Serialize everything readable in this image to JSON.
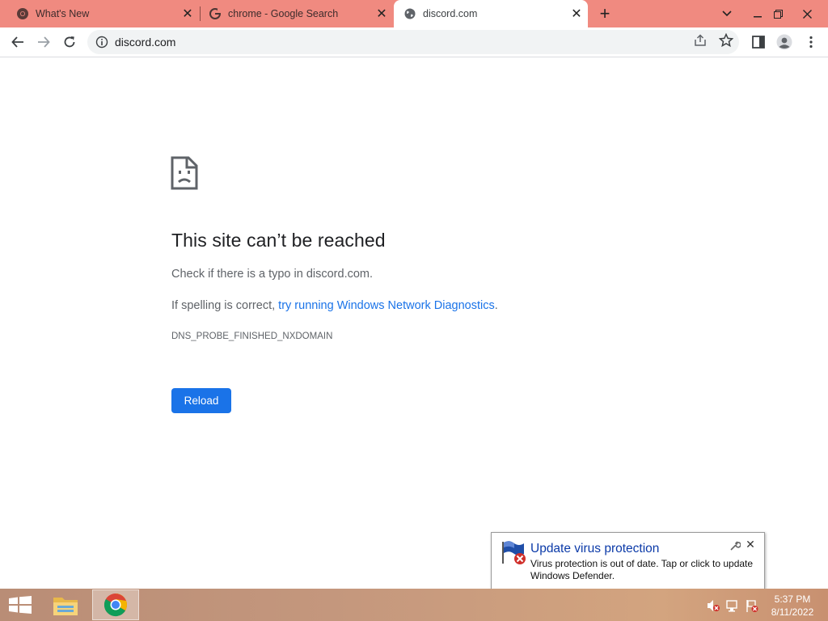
{
  "browser": {
    "tabs": [
      {
        "title": "What's New",
        "icon": "chrome-icon",
        "active": false
      },
      {
        "title": "chrome - Google Search",
        "icon": "google-icon",
        "active": false
      },
      {
        "title": "discord.com",
        "icon": "globe-icon",
        "active": true
      }
    ],
    "new_tab_symbol": "+",
    "address": "discord.com"
  },
  "error_page": {
    "title": "This site can’t be reached",
    "line1": "Check if there is a typo in discord.com.",
    "line2_prefix": "If spelling is correct, ",
    "line2_link": "try running Windows Network Diagnostics",
    "line2_suffix": ".",
    "error_code": "DNS_PROBE_FINISHED_NXDOMAIN",
    "reload_label": "Reload",
    "accent": "#1a73e8"
  },
  "notification": {
    "title": "Update virus protection",
    "body": "Virus protection is out of date. Tap or click to update Windows Defender."
  },
  "taskbar": {
    "time": "5:37 PM",
    "date": "8/11/2022"
  },
  "colors": {
    "tabstrip": "#f08a80",
    "link": "#1a73e8"
  }
}
